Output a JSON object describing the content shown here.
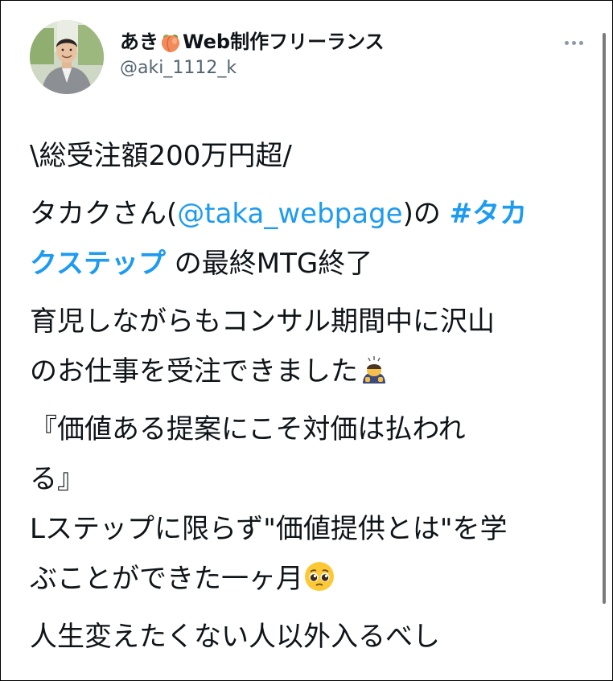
{
  "author": {
    "name_prefix": "あき",
    "name_suffix": "Web制作フリーランス",
    "name_icon": "peach-emoji",
    "handle": "@aki_1112_k"
  },
  "menu_icon": "more-horizontal-icon",
  "tweet": {
    "line1": "\\総受注額200万円超/",
    "line2_prefix": "タカクさん(",
    "line2_mention": "@taka_webpage",
    "line2_mid": ")の ",
    "line2_hashtag_a": "#タカ",
    "line3_hashtag_b": "クステップ",
    "line3_suffix": " の最終MTG終了",
    "line4": "育児しながらもコンサル期間中に沢山",
    "line5": "のお仕事を受注できました",
    "line5_icon": "bowing-person-emoji",
    "line6": "『価値ある提案にこそ対価は払われ",
    "line7": "る』",
    "line8": "Lステップに限らず\"価値提供とは\"を学",
    "line9": "ぶことができた一ヶ月",
    "line9_icon": "pleading-face-emoji",
    "line10": "人生変えたくない人以外入るべし"
  },
  "colors": {
    "link": "#1d9bf0",
    "text": "#0f1419",
    "muted": "#536471"
  }
}
